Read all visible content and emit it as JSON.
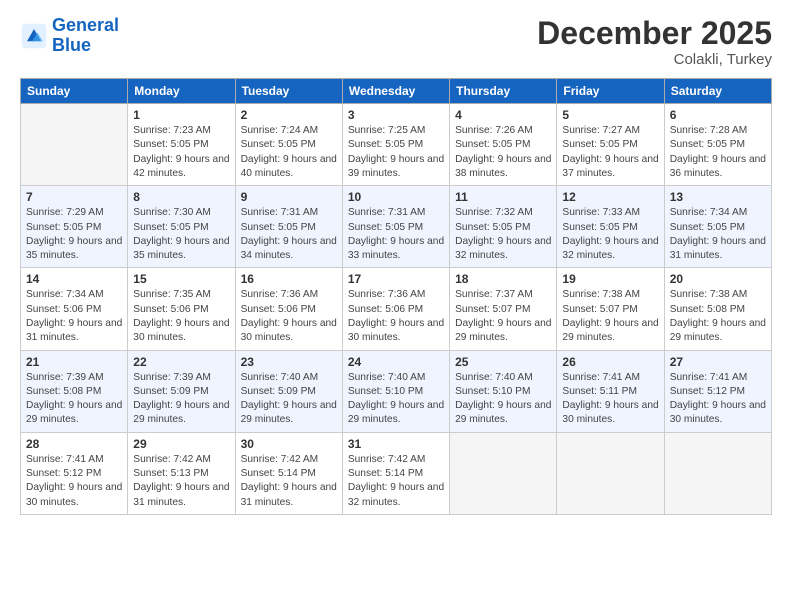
{
  "header": {
    "logo_line1": "General",
    "logo_line2": "Blue",
    "main_title": "December 2025",
    "subtitle": "Colakli, Turkey"
  },
  "weekdays": [
    "Sunday",
    "Monday",
    "Tuesday",
    "Wednesday",
    "Thursday",
    "Friday",
    "Saturday"
  ],
  "weeks": [
    [
      {
        "day": "",
        "sunrise": "",
        "sunset": "",
        "daylight": ""
      },
      {
        "day": "1",
        "sunrise": "7:23 AM",
        "sunset": "5:05 PM",
        "daylight": "9 hours and 42 minutes."
      },
      {
        "day": "2",
        "sunrise": "7:24 AM",
        "sunset": "5:05 PM",
        "daylight": "9 hours and 40 minutes."
      },
      {
        "day": "3",
        "sunrise": "7:25 AM",
        "sunset": "5:05 PM",
        "daylight": "9 hours and 39 minutes."
      },
      {
        "day": "4",
        "sunrise": "7:26 AM",
        "sunset": "5:05 PM",
        "daylight": "9 hours and 38 minutes."
      },
      {
        "day": "5",
        "sunrise": "7:27 AM",
        "sunset": "5:05 PM",
        "daylight": "9 hours and 37 minutes."
      },
      {
        "day": "6",
        "sunrise": "7:28 AM",
        "sunset": "5:05 PM",
        "daylight": "9 hours and 36 minutes."
      }
    ],
    [
      {
        "day": "7",
        "sunrise": "7:29 AM",
        "sunset": "5:05 PM",
        "daylight": "9 hours and 35 minutes."
      },
      {
        "day": "8",
        "sunrise": "7:30 AM",
        "sunset": "5:05 PM",
        "daylight": "9 hours and 35 minutes."
      },
      {
        "day": "9",
        "sunrise": "7:31 AM",
        "sunset": "5:05 PM",
        "daylight": "9 hours and 34 minutes."
      },
      {
        "day": "10",
        "sunrise": "7:31 AM",
        "sunset": "5:05 PM",
        "daylight": "9 hours and 33 minutes."
      },
      {
        "day": "11",
        "sunrise": "7:32 AM",
        "sunset": "5:05 PM",
        "daylight": "9 hours and 32 minutes."
      },
      {
        "day": "12",
        "sunrise": "7:33 AM",
        "sunset": "5:05 PM",
        "daylight": "9 hours and 32 minutes."
      },
      {
        "day": "13",
        "sunrise": "7:34 AM",
        "sunset": "5:05 PM",
        "daylight": "9 hours and 31 minutes."
      }
    ],
    [
      {
        "day": "14",
        "sunrise": "7:34 AM",
        "sunset": "5:06 PM",
        "daylight": "9 hours and 31 minutes."
      },
      {
        "day": "15",
        "sunrise": "7:35 AM",
        "sunset": "5:06 PM",
        "daylight": "9 hours and 30 minutes."
      },
      {
        "day": "16",
        "sunrise": "7:36 AM",
        "sunset": "5:06 PM",
        "daylight": "9 hours and 30 minutes."
      },
      {
        "day": "17",
        "sunrise": "7:36 AM",
        "sunset": "5:06 PM",
        "daylight": "9 hours and 30 minutes."
      },
      {
        "day": "18",
        "sunrise": "7:37 AM",
        "sunset": "5:07 PM",
        "daylight": "9 hours and 29 minutes."
      },
      {
        "day": "19",
        "sunrise": "7:38 AM",
        "sunset": "5:07 PM",
        "daylight": "9 hours and 29 minutes."
      },
      {
        "day": "20",
        "sunrise": "7:38 AM",
        "sunset": "5:08 PM",
        "daylight": "9 hours and 29 minutes."
      }
    ],
    [
      {
        "day": "21",
        "sunrise": "7:39 AM",
        "sunset": "5:08 PM",
        "daylight": "9 hours and 29 minutes."
      },
      {
        "day": "22",
        "sunrise": "7:39 AM",
        "sunset": "5:09 PM",
        "daylight": "9 hours and 29 minutes."
      },
      {
        "day": "23",
        "sunrise": "7:40 AM",
        "sunset": "5:09 PM",
        "daylight": "9 hours and 29 minutes."
      },
      {
        "day": "24",
        "sunrise": "7:40 AM",
        "sunset": "5:10 PM",
        "daylight": "9 hours and 29 minutes."
      },
      {
        "day": "25",
        "sunrise": "7:40 AM",
        "sunset": "5:10 PM",
        "daylight": "9 hours and 29 minutes."
      },
      {
        "day": "26",
        "sunrise": "7:41 AM",
        "sunset": "5:11 PM",
        "daylight": "9 hours and 30 minutes."
      },
      {
        "day": "27",
        "sunrise": "7:41 AM",
        "sunset": "5:12 PM",
        "daylight": "9 hours and 30 minutes."
      }
    ],
    [
      {
        "day": "28",
        "sunrise": "7:41 AM",
        "sunset": "5:12 PM",
        "daylight": "9 hours and 30 minutes."
      },
      {
        "day": "29",
        "sunrise": "7:42 AM",
        "sunset": "5:13 PM",
        "daylight": "9 hours and 31 minutes."
      },
      {
        "day": "30",
        "sunrise": "7:42 AM",
        "sunset": "5:14 PM",
        "daylight": "9 hours and 31 minutes."
      },
      {
        "day": "31",
        "sunrise": "7:42 AM",
        "sunset": "5:14 PM",
        "daylight": "9 hours and 32 minutes."
      },
      {
        "day": "",
        "sunrise": "",
        "sunset": "",
        "daylight": ""
      },
      {
        "day": "",
        "sunrise": "",
        "sunset": "",
        "daylight": ""
      },
      {
        "day": "",
        "sunrise": "",
        "sunset": "",
        "daylight": ""
      }
    ]
  ]
}
